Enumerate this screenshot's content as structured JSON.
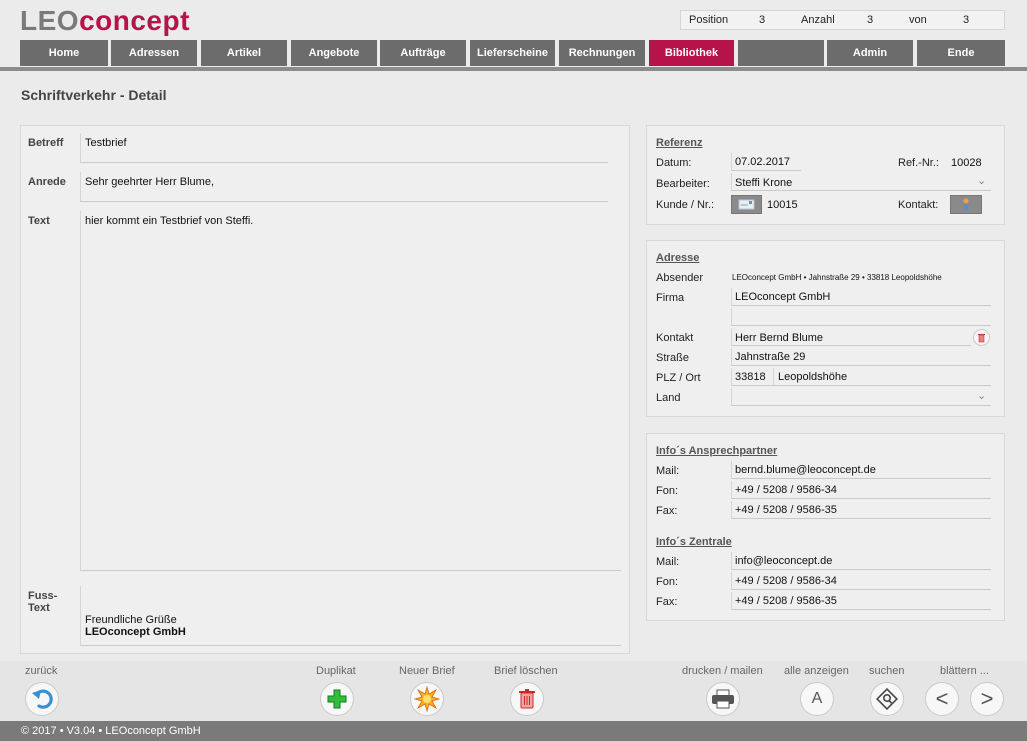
{
  "app": {
    "logo_part1": "LEO",
    "logo_part2": "concept"
  },
  "status": {
    "position_label": "Position",
    "position_value": "3",
    "count_label": "Anzahl",
    "count_value": "3",
    "of_label": "von",
    "of_value": "3"
  },
  "nav": {
    "home": "Home",
    "addresses": "Adressen",
    "articles": "Artikel",
    "offers": "Angebote",
    "orders": "Aufträge",
    "delivery": "Lieferscheine",
    "invoices": "Rechnungen",
    "library": "Bibliothek",
    "admin": "Admin",
    "end": "Ende"
  },
  "page": {
    "title": "Schriftverkehr - Detail"
  },
  "letter": {
    "subject_label": "Betreff",
    "subject_value": "Testbrief",
    "salutation_label": "Anrede",
    "salutation_value": "Sehr geehrter Herr Blume,",
    "text_label": "Text",
    "text_value": "hier kommt ein Testbrief von Steffi.",
    "foot_label_1": "Fuss-",
    "foot_label_2": "Text",
    "foot_line1": "Freundliche Grüße",
    "foot_line2": "LEOconcept GmbH"
  },
  "reference": {
    "title": "Referenz",
    "date_label": "Datum:",
    "date_value": "07.02.2017",
    "refnr_label": "Ref.-Nr.:",
    "refnr_value": "10028",
    "editor_label": "Bearbeiter:",
    "editor_value": "Steffi Krone",
    "customer_label": "Kunde / Nr.:",
    "customer_value": "10015",
    "contact_label": "Kontakt:"
  },
  "address": {
    "title": "Adresse",
    "sender_label": "Absender",
    "sender_value": "LEOconcept GmbH • Jahnstraße 29 • 33818 Leopoldshöhe",
    "company_label": "Firma",
    "company_value": "LEOconcept GmbH",
    "contact_label": "Kontakt",
    "contact_value": "Herr Bernd  Blume",
    "street_label": "Straße",
    "street_value": "Jahnstraße 29",
    "city_label": "PLZ / Ort",
    "zip_value": "33818",
    "city_value": "Leopoldshöhe",
    "country_label": "Land",
    "country_value": ""
  },
  "contact_info": {
    "title": "Info´s Ansprechpartner",
    "mail_label": "Mail:",
    "mail_value": "bernd.blume@leoconcept.de",
    "phone_label": "Fon:",
    "phone_value": "+49 / 5208 / 9586-34",
    "fax_label": "Fax:",
    "fax_value": "+49 / 5208 / 9586-35"
  },
  "central_info": {
    "title": "Info´s Zentrale",
    "mail_label": "Mail:",
    "mail_value": "info@leoconcept.de",
    "phone_label": "Fon:",
    "phone_value": "+49 / 5208 / 9586-34",
    "fax_label": "Fax:",
    "fax_value": "+49 / 5208 / 9586-35"
  },
  "actions": {
    "back": "zurück",
    "duplicate": "Duplikat",
    "new_letter": "Neuer Brief",
    "delete_letter": "Brief löschen",
    "print_mail": "drucken / mailen",
    "show_all": "alle anzeigen",
    "search": "suchen",
    "browse": "blättern ...",
    "show_all_glyph": "A",
    "prev_glyph": "<",
    "next_glyph": ">"
  },
  "footer": {
    "text": "© 2017 • V3.04 • LEOconcept GmbH"
  },
  "colors": {
    "accent": "#b5134a",
    "nav": "#6c6c6c",
    "footer": "#7a7a7a"
  }
}
